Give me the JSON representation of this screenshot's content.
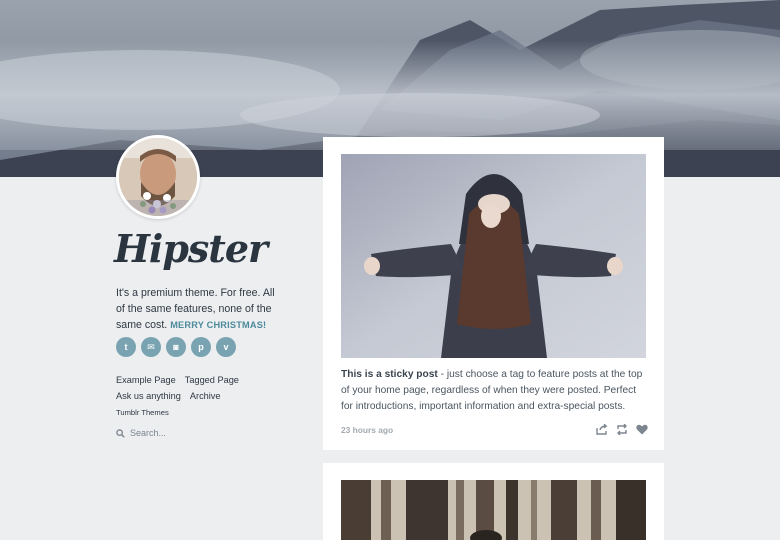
{
  "blog": {
    "title": "Hipster",
    "description_main": "It's a premium theme. For free. All of the same features, none of the same cost.",
    "description_accent": "MERRY CHRISTMAS!"
  },
  "social": [
    {
      "icon": "twitter-icon",
      "glyph": "t"
    },
    {
      "icon": "mail-icon",
      "glyph": "✉"
    },
    {
      "icon": "instagram-icon",
      "glyph": "◙"
    },
    {
      "icon": "pinterest-icon",
      "glyph": "p"
    },
    {
      "icon": "vimeo-icon",
      "glyph": "v"
    }
  ],
  "nav": {
    "example_page": "Example Page",
    "tagged_page": "Tagged Page",
    "ask": "Ask us anything",
    "archive": "Archive",
    "tumblr_themes": "Tumblr Themes"
  },
  "search": {
    "placeholder": "Search..."
  },
  "posts": [
    {
      "lead": "This is a sticky post",
      "body": " - just choose a tag to feature posts at the top of your home page, regardless of when they were posted. Perfect for introductions, important information and extra-special posts.",
      "timestamp": "23 hours ago",
      "actions": [
        "share-icon",
        "reblog-icon",
        "heart-icon"
      ]
    }
  ],
  "colors": {
    "accent": "#4d8a9c",
    "social_bg": "#7aa3b1",
    "page_bg": "#eceef0"
  }
}
